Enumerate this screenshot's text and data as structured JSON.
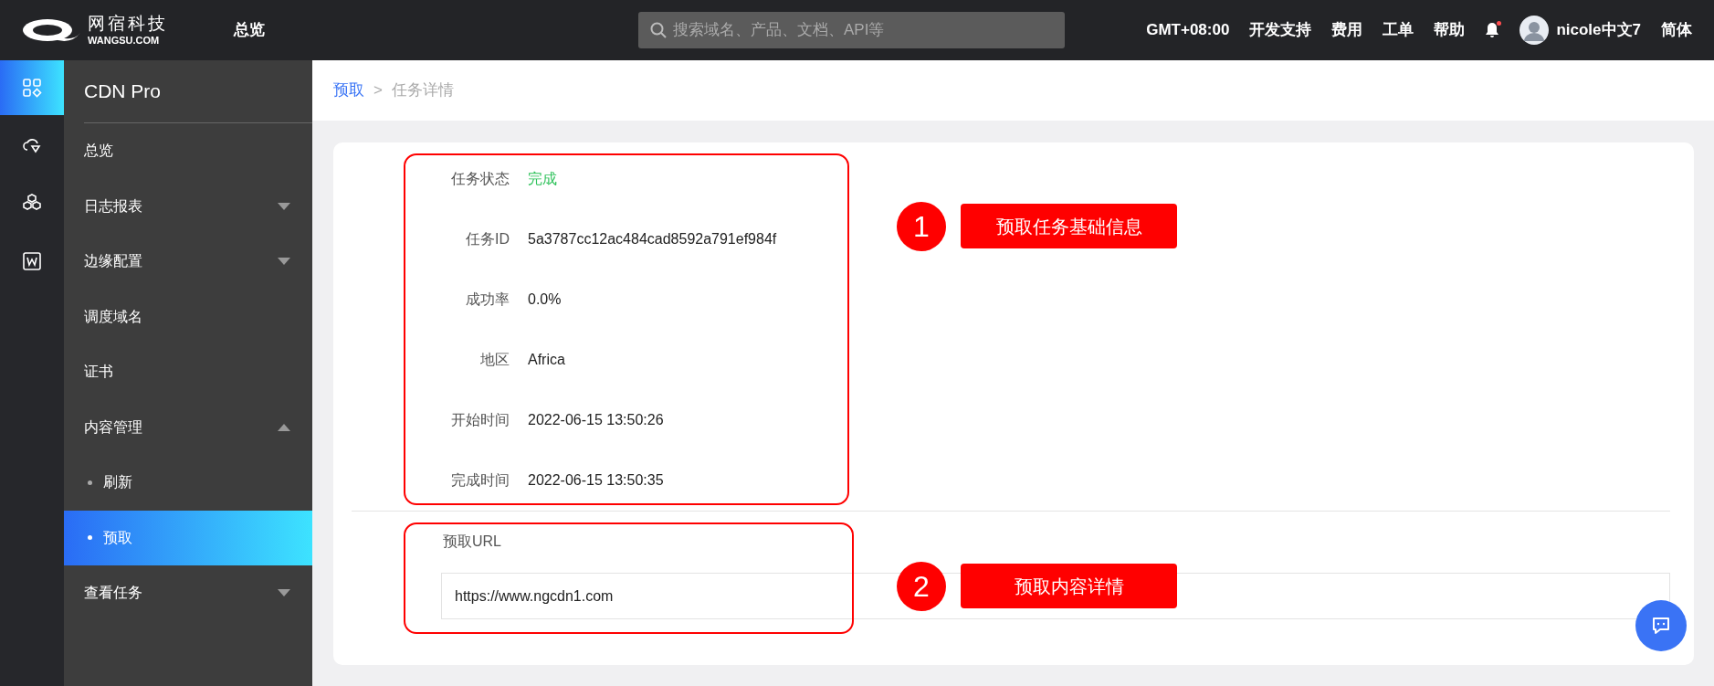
{
  "topbar": {
    "logo": {
      "cn": "网宿科技",
      "en": "WANGSU.COM"
    },
    "nav": "总览",
    "search": {
      "placeholder": "搜索域名、产品、文档、API等"
    },
    "links": [
      "GMT+08:00",
      "开发支持",
      "费用",
      "工单",
      "帮助"
    ],
    "notification": true,
    "user": "nicole中文7",
    "language": "简体"
  },
  "rail": [
    {
      "kind": "grid",
      "selected": true
    },
    {
      "kind": "cloud",
      "selected": false
    },
    {
      "kind": "cubes",
      "selected": false
    },
    {
      "kind": "w",
      "selected": false
    }
  ],
  "sidebar": {
    "title": "CDN Pro",
    "items": [
      {
        "label": "总览",
        "selected": false
      },
      {
        "label": "日志报表",
        "selected": false,
        "expanded": false
      },
      {
        "label": "边缘配置",
        "selected": false,
        "expanded": false
      },
      {
        "label": "调度域名",
        "selected": false
      },
      {
        "label": "证书",
        "selected": false
      },
      {
        "label": "内容管理",
        "selected": false,
        "expanded": true,
        "children": [
          {
            "label": "刷新",
            "selected": false
          },
          {
            "label": "预取",
            "selected": true
          }
        ]
      },
      {
        "label": "查看任务",
        "selected": false,
        "expanded": false
      }
    ]
  },
  "breadcrumb": {
    "link": "预取",
    "separator": ">",
    "current": "任务详情"
  },
  "details": [
    {
      "label": "任务状态",
      "value": "完成",
      "kind": "status"
    },
    {
      "label": "任务ID",
      "value": "5a3787cc12ac484cad8592a791ef984f",
      "kind": "text"
    },
    {
      "label": "成功率",
      "value": "0.0%",
      "kind": "text"
    },
    {
      "label": "地区",
      "value": "Africa",
      "kind": "text"
    },
    {
      "label": "开始时间",
      "value": "2022-06-15 13:50:26",
      "kind": "text"
    },
    {
      "label": "完成时间",
      "value": "2022-06-15 13:50:35",
      "kind": "text"
    }
  ],
  "url_section": {
    "label": "预取URL",
    "value": "https://www.ngcdn1.com"
  },
  "annotations": [
    {
      "number": "1",
      "label": "预取任务基础信息"
    },
    {
      "number": "2",
      "label": "预取内容详情"
    }
  ]
}
